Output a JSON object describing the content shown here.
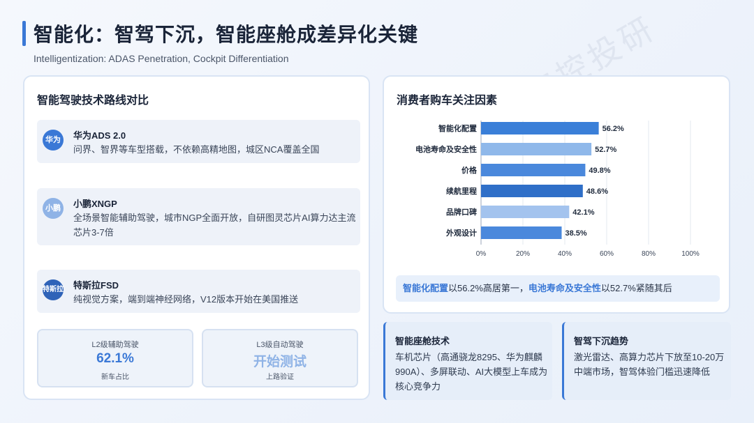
{
  "watermark": "交控投研",
  "header": {
    "title": "智能化：智驾下沉，智能座舱成差异化关键",
    "subtitle": "Intelligentization: ADAS Penetration, Cockpit Differentiation"
  },
  "left_card": {
    "heading": "智能驾驶技术路线对比",
    "routes": [
      {
        "icon": "华为",
        "icon_color": "#3a78d6",
        "name": "华为ADS 2.0",
        "desc": "问界、智界等车型搭载，不依赖高精地图，城区NCA覆盖全国"
      },
      {
        "icon": "小鹏",
        "icon_color": "#8fb3e6",
        "name": "小鹏XNGP",
        "desc": "全场景智能辅助驾驶，城市NGP全面开放，自研图灵芯片AI算力达主流芯片3-7倍"
      },
      {
        "icon": "特斯拉",
        "icon_color": "#2f63b8",
        "name": "特斯拉FSD",
        "desc": "纯视觉方案，端到端神经网络，V12版本开始在美国推送"
      }
    ],
    "stats": [
      {
        "label": "L2级辅助驾驶",
        "value": "62.1%",
        "foot": "新车占比",
        "color": "#3a78d6"
      },
      {
        "label": "L3级自动驾驶",
        "value": "开始测试",
        "foot": "上路验证",
        "color": "#8fb3e6"
      }
    ]
  },
  "right_card": {
    "heading": "消费者购车关注因素",
    "note_part1": "智能化配置",
    "note_part2": "以56.2%高居第一，",
    "note_part3": "电池寿命及安全性",
    "note_part4": "以52.7%紧随其后"
  },
  "chart_data": {
    "type": "bar",
    "orientation": "horizontal",
    "title": "消费者购车关注因素",
    "categories": [
      "智能化配置",
      "电池寿命及安全性",
      "价格",
      "续航里程",
      "品牌口碑",
      "外观设计"
    ],
    "values": [
      56.2,
      52.7,
      49.8,
      48.6,
      42.1,
      38.5
    ],
    "data_labels": [
      "56.2%",
      "52.7%",
      "49.8%",
      "48.6%",
      "42.1%",
      "38.5%"
    ],
    "bar_colors": [
      "#3a7fd8",
      "#8fb8ea",
      "#4a88dc",
      "#2f6fc8",
      "#a3c3ee",
      "#4a88dc"
    ],
    "xlim": [
      0,
      100
    ],
    "xticks": [
      "0%",
      "20%",
      "40%",
      "60%",
      "80%",
      "100%"
    ],
    "grid": true
  },
  "mini_cards": [
    {
      "title": "智能座舱技术",
      "text": "车机芯片（高通骁龙8295、华为麒麟990A）、多屏联动、AI大模型上车成为核心竞争力"
    },
    {
      "title": "智驾下沉趋势",
      "text": "激光雷达、高算力芯片下放至10-20万中端市场，智驾体验门槛迅速降低"
    }
  ]
}
